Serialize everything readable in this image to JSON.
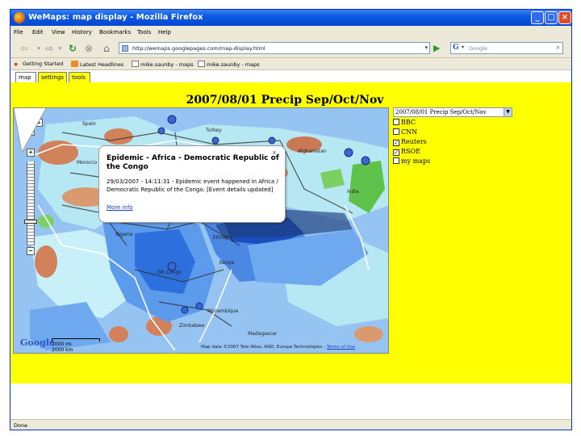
{
  "window": {
    "title": "WeMaps: map display - Mozilla Firefox"
  },
  "menu": [
    "File",
    "Edit",
    "View",
    "History",
    "Bookmarks",
    "Tools",
    "Help"
  ],
  "navbar": {
    "url": "http://wemaps.googlepages.com/map-display.html",
    "search_placeholder": "Google"
  },
  "bookmarks": [
    "Getting Started",
    "Latest Headlines",
    "mike.saunby - maps",
    "mike.saunby - maps"
  ],
  "tabs": [
    "map",
    "settings",
    "tools"
  ],
  "map": {
    "title": "2007/08/01 Precip Sep/Oct/Nov",
    "labels": {
      "turkey": "Turkey",
      "afghanistan": "Afghanistan",
      "india": "India",
      "nigeria": "Nigeria",
      "ethiopia": "Ethiopia",
      "kenya": "Kenya",
      "dr_congo": "DR Congo",
      "mozambique": "Mozambique",
      "zimbabwe": "Zimbabwe",
      "madagascar": "Madagascar",
      "spain": "Spain",
      "morocco": "Morocco"
    },
    "scale": {
      "miles": "1000 mi",
      "km": "2000 km"
    },
    "logo": "Google",
    "copyright": "Map data ©2007 Tele Atlas, AND, Europa Technologies -",
    "terms": "Terms of Use"
  },
  "infowindow": {
    "title": "Epidemic - Africa - Democratic Republic of the Congo",
    "body": "29/03/2007 - 14:11:31 - Epidemic event happened in Africa / Democratic Republic of the Congo. [Event details updated]",
    "link": "More info",
    "close": "x"
  },
  "layers": {
    "selected": "2007/08/01 Precip Sep/Oct/Nov",
    "items": [
      {
        "label": "BBC",
        "checked": false
      },
      {
        "label": "CNN",
        "checked": false
      },
      {
        "label": "Reuters",
        "checked": true
      },
      {
        "label": "RSOE",
        "checked": true
      },
      {
        "label": "my maps",
        "checked": false
      }
    ]
  },
  "status": "Done",
  "colors": {
    "page_bg": "#ffff00",
    "sea": "#95c4f2",
    "precip_mid": "#3a7ee0",
    "precip_low": "#b6e8f4",
    "dry": "#d2825a"
  }
}
